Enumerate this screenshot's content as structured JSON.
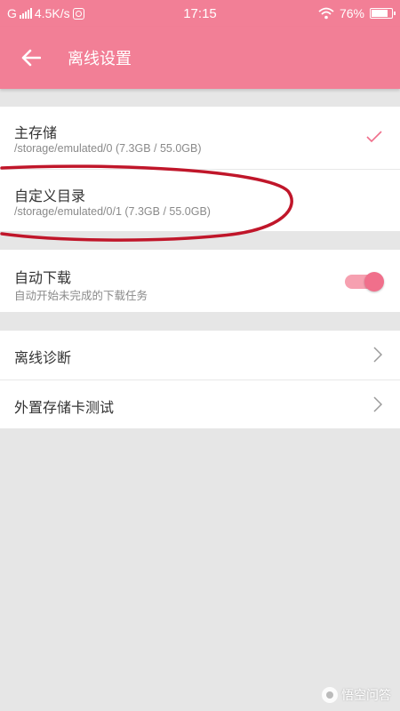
{
  "status_bar": {
    "carrier": "G",
    "network_speed": "4.5K/s",
    "time": "17:15",
    "battery": "76%",
    "battery_level": 0.76
  },
  "app_bar": {
    "title": "离线设置",
    "back_icon": "arrow-left-icon"
  },
  "storage": {
    "items": [
      {
        "title": "主存储",
        "path": "/storage/emulated/0 (7.3GB / 55.0GB)",
        "selected": true
      },
      {
        "title": "自定义目录",
        "path": "/storage/emulated/0/1 (7.3GB / 55.0GB)",
        "selected": false
      }
    ]
  },
  "auto_download": {
    "title": "自动下载",
    "subtitle": "自动开始未完成的下载任务",
    "enabled": true
  },
  "tools": {
    "items": [
      {
        "title": "离线诊断"
      },
      {
        "title": "外置存储卡测试"
      }
    ]
  },
  "watermark": {
    "text": "悟空问答"
  },
  "colors": {
    "accent": "#f27f96",
    "toggle_knob": "#f06f8b",
    "annotation": "#c0162a"
  }
}
